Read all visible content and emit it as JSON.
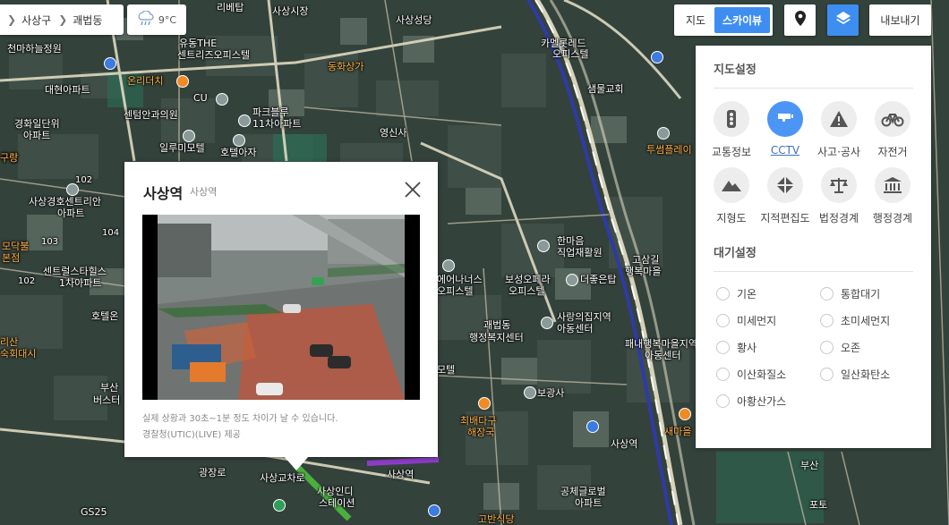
{
  "breadcrumb": {
    "district": "사상구",
    "dong": "괘법동"
  },
  "weather": {
    "temperature": "9°C",
    "icon": "cloud-rain-icon"
  },
  "map_type": {
    "map_label": "지도",
    "skyview_label": "스카이뷰",
    "selected": "스카이뷰"
  },
  "toolbar": {
    "export_label": "내보내기",
    "layers_icon": "layers-icon",
    "location_icon": "location-pin-icon"
  },
  "settings": {
    "map_title": "지도설정",
    "layers": [
      {
        "label": "교통정보",
        "icon": "traffic-light-icon",
        "active": false
      },
      {
        "label": "CCTV",
        "icon": "cctv-icon",
        "active": true
      },
      {
        "label": "사고·공사",
        "icon": "warning-icon",
        "active": false
      },
      {
        "label": "자전거",
        "icon": "bicycle-icon",
        "active": false
      },
      {
        "label": "지형도",
        "icon": "mountain-icon",
        "active": false
      },
      {
        "label": "지적편집도",
        "icon": "parcel-icon",
        "active": false
      },
      {
        "label": "법정경계",
        "icon": "scales-icon",
        "active": false
      },
      {
        "label": "행정경계",
        "icon": "government-icon",
        "active": false
      }
    ],
    "air_title": "대기설정",
    "air_options": [
      "기온",
      "통합대기",
      "미세먼지",
      "초미세먼지",
      "황사",
      "오존",
      "이산화질소",
      "일산화탄소",
      "아황산가스"
    ]
  },
  "cctv": {
    "title": "사상역",
    "subtitle": "사상역",
    "note": "실제 상황과 30초~1분 정도 차이가 날 수 있습니다.",
    "source": "경찰청(UTIC)(LIVE) 제공"
  },
  "map_labels": {
    "l1": "리베탑",
    "l2": "사상시장",
    "l3": "천마하늘정원",
    "l4": "유동THE",
    "l5": "센트리즈오피스텔",
    "l6": "동화상가",
    "l7": "사상성당",
    "l8": "카멜롯레드",
    "l9": "오피스텔",
    "l10": "대현아파트",
    "l11": "온리더치",
    "l12": "CU",
    "l13": "센텀안과의원",
    "l14": "파크블루",
    "l15": "11차아파트",
    "l16": "샘물교회",
    "l17": "경화일단위",
    "l18": "아파트",
    "l19": "일루미모텔",
    "l20": "호텔아자",
    "l21": "영신사",
    "l22": "투썸플레이",
    "l23": "구청",
    "l24": "사상경호센트리안",
    "l25": "아파트",
    "l26": "한마음",
    "l27": "직업재활원",
    "l28": "고삼길",
    "l29": "행복마을",
    "l30": "모닥불",
    "l31": "본점",
    "l32": "센트럴스타힐스",
    "l33": "1차아파트",
    "l34": "에어나너스",
    "l35": "오피스텔",
    "l36": "보성오페라",
    "l37": "오피스텔",
    "l38": "더좋은탑",
    "l39": "괘법동",
    "l40": "행정복지센터",
    "l41": "사랑의집지역",
    "l42": "아동센터",
    "l43": "패내행복마을지역",
    "l44": "아동센터",
    "l45": "호텔온",
    "l46": "모텔",
    "l47": "보광사",
    "l48": "최배다구",
    "l49": "해장국",
    "l50": "사상역",
    "l51": "새마을",
    "l52": "광장로",
    "l53": "사상교차로",
    "l54": "사상인디",
    "l55": "스테이션",
    "l56": "사상역",
    "l57": "공체글로벌",
    "l58": "아파트",
    "l59": "고반식당",
    "l60": "GS25",
    "l61": "부산",
    "l62": "버스터",
    "l63": "구랑",
    "l64": "리산",
    "l65": "숙회대시",
    "l66": "102",
    "l67": "103",
    "l68": "104",
    "l69": "102",
    "l70": "부산",
    "l71": "포토"
  }
}
